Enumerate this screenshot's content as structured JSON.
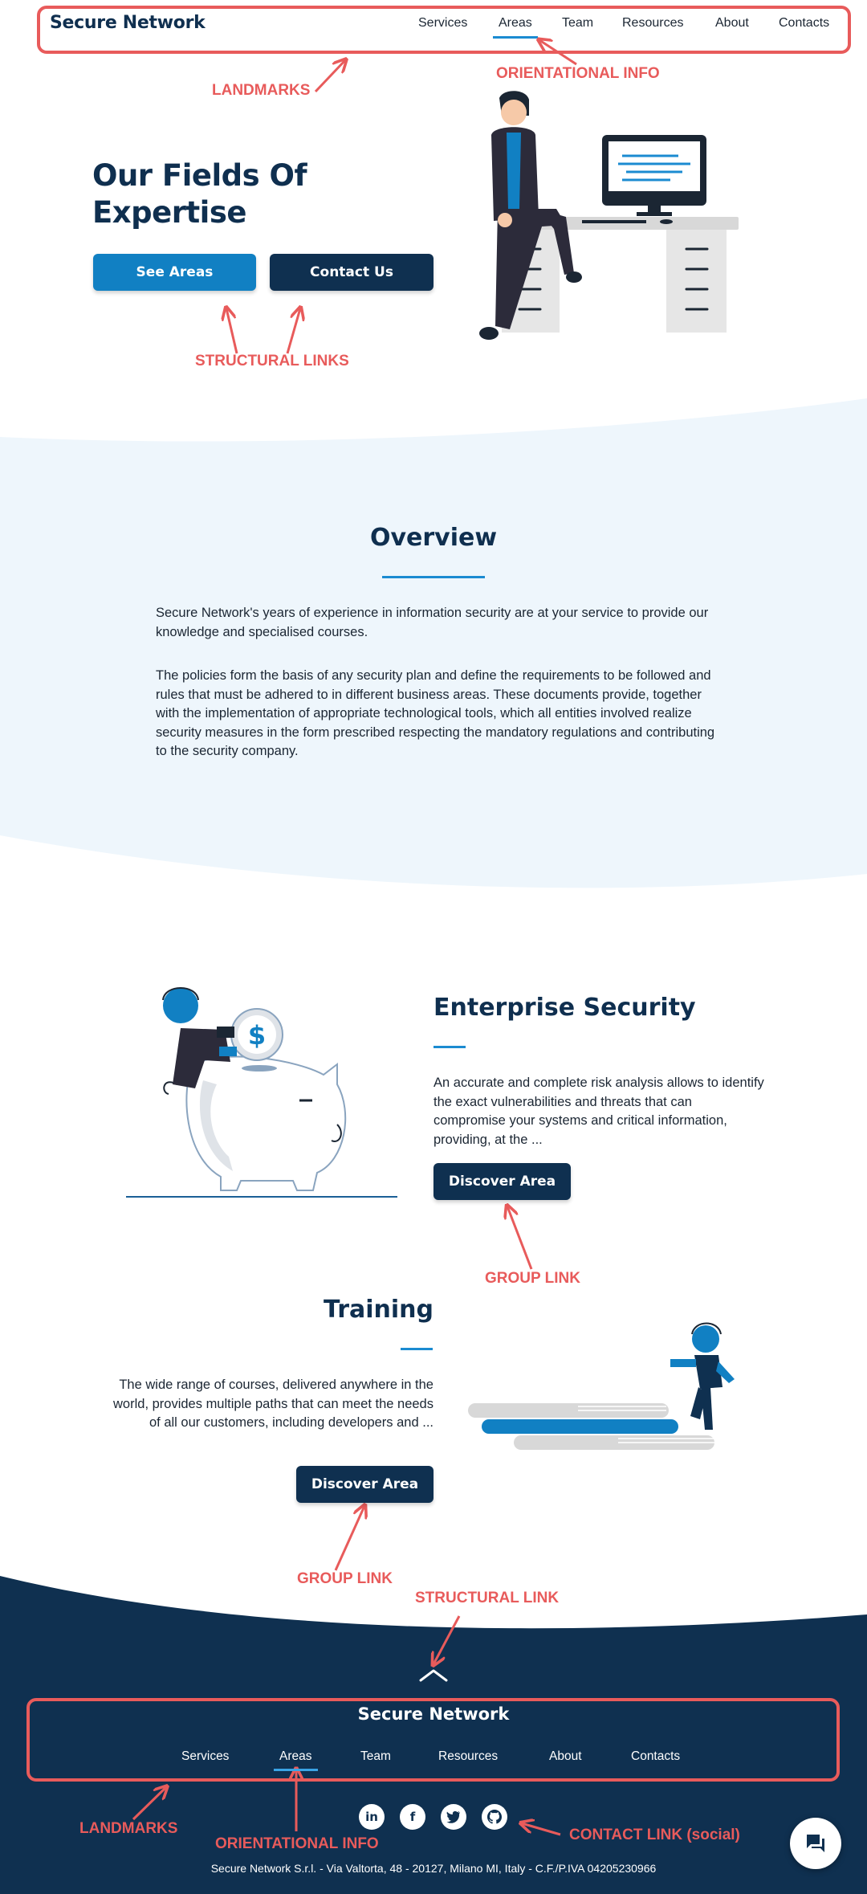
{
  "brand": "Secure Network",
  "nav": {
    "items": [
      "Services",
      "Areas",
      "Team",
      "Resources",
      "About",
      "Contacts"
    ],
    "active": "Areas"
  },
  "hero": {
    "title": "Our Fields Of Expertise",
    "buttons": {
      "see_areas": "See Areas",
      "contact_us": "Contact Us"
    }
  },
  "overview": {
    "title": "Overview",
    "paragraphs": [
      "Secure Network's years of experience in information security are at your service to provide our knowledge and specialised courses.",
      "The policies form the basis of any security plan and define the requirements to be followed and rules that must be adhered to in different business areas. These documents provide, together with the implementation of appropriate technological tools, which all entities involved realize security measures in the form prescribed respecting the mandatory regulations and contributing to the security company."
    ]
  },
  "areas": [
    {
      "title": "Enterprise Security",
      "description": "An accurate and complete risk analysis allows to identify the exact vulnerabilities and threats that can compromise your systems and critical information, providing, at the ...",
      "button": "Discover Area"
    },
    {
      "title": "Training",
      "description": "The wide range of courses, delivered anywhere in the world, provides multiple paths that can meet the needs of all our customers, including developers and ...",
      "button": "Discover Area"
    }
  ],
  "footer": {
    "brand": "Secure Network",
    "nav": [
      "Services",
      "Areas",
      "Team",
      "Resources",
      "About",
      "Contacts"
    ],
    "active": "Areas",
    "social": [
      "linkedin-icon",
      "facebook-icon",
      "twitter-icon",
      "github-icon"
    ],
    "legal": "Secure Network S.r.l. - Via Valtorta, 48 - 20127, Milano MI, Italy - C.F./P.IVA 04205230966"
  },
  "annotations": {
    "landmarks_top": "LANDMARKS",
    "orientational_top": "ORIENTATIONAL INFO",
    "structural_links": "STRUCTURAL LINKS",
    "group_link_1": "GROUP LINK",
    "group_link_2": "GROUP LINK",
    "structural_link": "STRUCTURAL LINK",
    "landmarks_bottom": "LANDMARKS",
    "orientational_bottom": "ORIENTATIONAL INFO",
    "contact_link": "CONTACT LINK (social)"
  },
  "colors": {
    "navy": "#0f3050",
    "blue": "#1180c3",
    "light_band": "#eef6fc",
    "annotation_red": "#e85b5b"
  }
}
